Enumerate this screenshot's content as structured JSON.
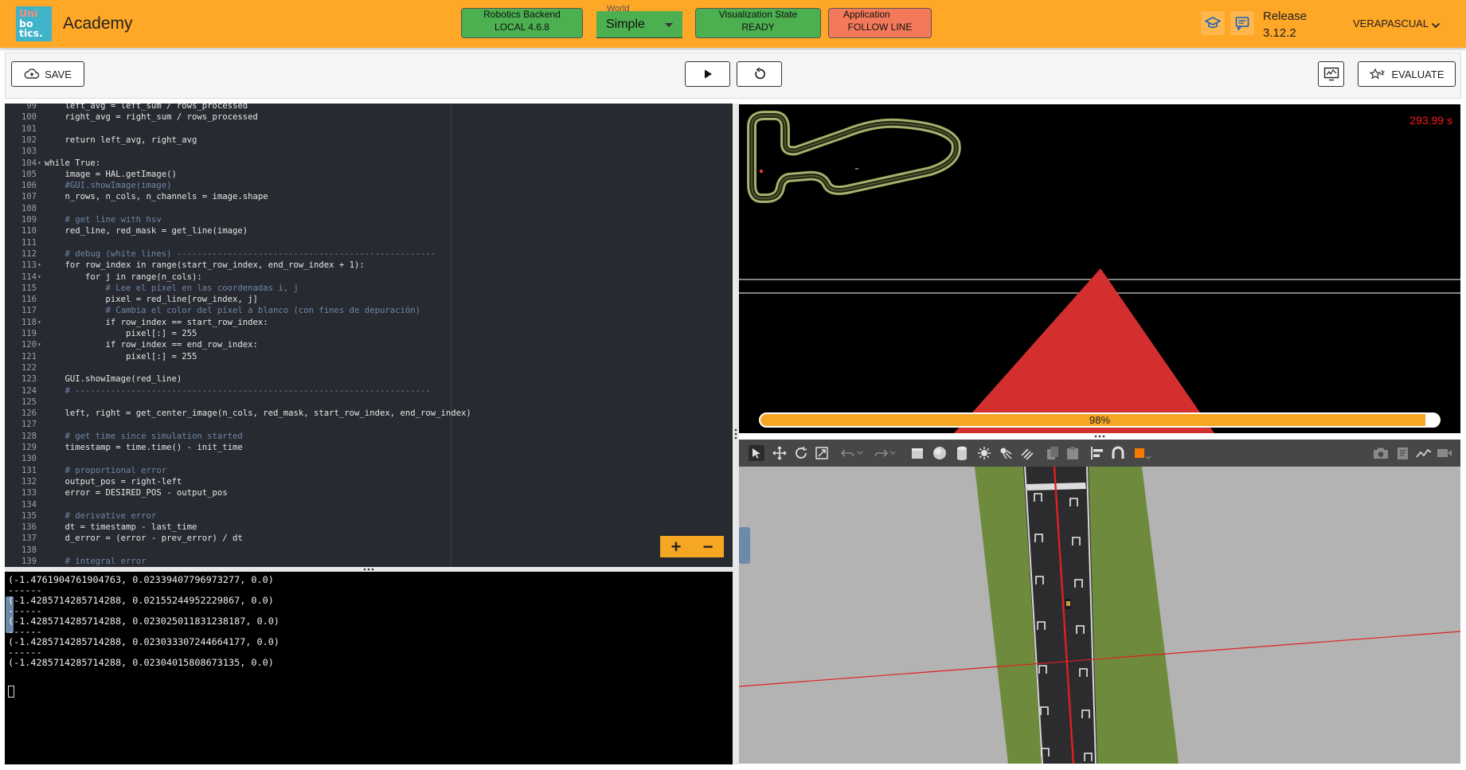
{
  "header": {
    "logo_lines": [
      "Uni",
      "bo",
      "tics."
    ],
    "title": "Academy",
    "robotics_backend": {
      "caption": "Robotics Backend",
      "value": "LOCAL 4.6.8"
    },
    "world": {
      "caption": "World",
      "value": "Simple"
    },
    "visualization_state": {
      "caption": "Visualization State",
      "value": "READY"
    },
    "application": {
      "caption": "Application",
      "value": "FOLLOW LINE"
    },
    "release_label": "Release",
    "release_version": "3.12.2",
    "user": "VERAPASCUAL"
  },
  "toolbar": {
    "save_label": "SAVE",
    "evaluate_label": "EVALUATE"
  },
  "editor": {
    "lines": [
      {
        "n": "99",
        "code": "    left_avg = left_sum / rows_processed"
      },
      {
        "n": "100",
        "code": "    right_avg = right_sum / rows_processed"
      },
      {
        "n": "101",
        "code": ""
      },
      {
        "n": "102",
        "code": "    return left_avg, right_avg"
      },
      {
        "n": "103",
        "code": ""
      },
      {
        "n": "104",
        "code": "while True:",
        "fold": true
      },
      {
        "n": "105",
        "code": "    image = HAL.getImage()"
      },
      {
        "n": "106",
        "code": "    #GUI.showImage(image)"
      },
      {
        "n": "107",
        "code": "    n_rows, n_cols, n_channels = image.shape"
      },
      {
        "n": "108",
        "code": ""
      },
      {
        "n": "109",
        "code": "    # get line with hsv"
      },
      {
        "n": "110",
        "code": "    red_line, red_mask = get_line(image)"
      },
      {
        "n": "111",
        "code": ""
      },
      {
        "n": "112",
        "code": "    # debug (white lines) ---------------------------------------------------"
      },
      {
        "n": "113",
        "code": "    for row_index in range(start_row_index, end_row_index + 1):",
        "fold": true
      },
      {
        "n": "114",
        "code": "        for j in range(n_cols):",
        "fold": true
      },
      {
        "n": "115",
        "code": "            # Lee el píxel en las coordenadas i, j"
      },
      {
        "n": "116",
        "code": "            pixel = red_line[row_index, j]"
      },
      {
        "n": "117",
        "code": "            # Cambia el color del píxel a blanco (con fines de depuración)"
      },
      {
        "n": "118",
        "code": "            if row_index == start_row_index:",
        "fold": true
      },
      {
        "n": "119",
        "code": "                pixel[:] = 255"
      },
      {
        "n": "120",
        "code": "            if row_index == end_row_index:",
        "fold": true
      },
      {
        "n": "121",
        "code": "                pixel[:] = 255"
      },
      {
        "n": "122",
        "code": ""
      },
      {
        "n": "123",
        "code": "    GUI.showImage(red_line)"
      },
      {
        "n": "124",
        "code": "    # ----------------------------------------------------------------------"
      },
      {
        "n": "125",
        "code": ""
      },
      {
        "n": "126",
        "code": "    left, right = get_center_image(n_cols, red_mask, start_row_index, end_row_index)"
      },
      {
        "n": "127",
        "code": ""
      },
      {
        "n": "128",
        "code": "    # get time since simulation started"
      },
      {
        "n": "129",
        "code": "    timestamp = time.time() - init_time"
      },
      {
        "n": "130",
        "code": ""
      },
      {
        "n": "131",
        "code": "    # proportional error"
      },
      {
        "n": "132",
        "code": "    output_pos = right-left"
      },
      {
        "n": "133",
        "code": "    error = DESIRED_POS - output_pos"
      },
      {
        "n": "134",
        "code": ""
      },
      {
        "n": "135",
        "code": "    # derivative error"
      },
      {
        "n": "136",
        "code": "    dt = timestamp - last_time"
      },
      {
        "n": "137",
        "code": "    d_error = (error - prev_error) / dt"
      },
      {
        "n": "138",
        "code": ""
      },
      {
        "n": "139",
        "code": "    # integral error"
      }
    ],
    "zoom_in": "+",
    "zoom_out": "−"
  },
  "terminal": {
    "lines": [
      "(-1.4761904761904763, 0.02339407796973277, 0.0)",
      "------",
      "(-1.4285714285714288, 0.02155244952229867, 0.0)",
      "------",
      "(-1.4285714285714288, 0.023025011831238187, 0.0)",
      "------",
      "(-1.4285714285714288, 0.023033307244664177, 0.0)",
      "------",
      "(-1.4285714285714288, 0.02304015808673135, 0.0)"
    ]
  },
  "viz": {
    "timer": "293.99 s",
    "progress_label": "98%",
    "progress_value": 0.98
  },
  "colors": {
    "header": "#ffa726",
    "green_button": "#4caf50",
    "red_button": "#f4795a",
    "accent": "#f5a623",
    "editor_bg": "#272a30",
    "timer": "#ff1a1a"
  }
}
